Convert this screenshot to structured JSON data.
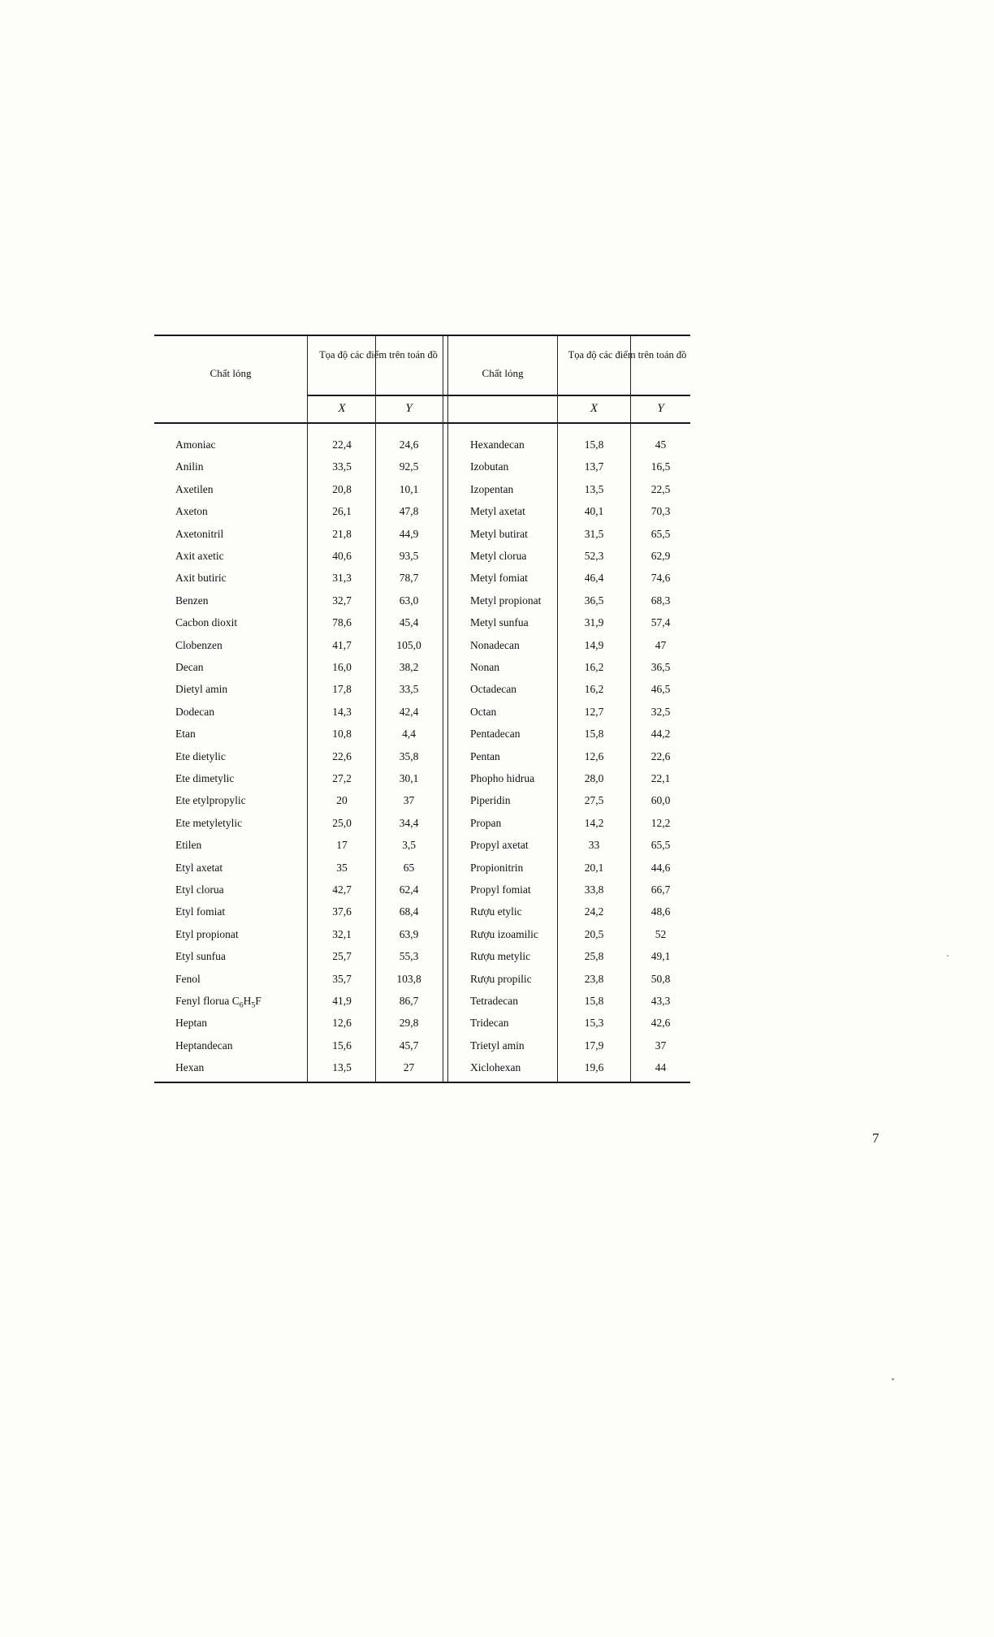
{
  "document": {
    "page_number": "7",
    "language": "vi"
  },
  "table": {
    "headers": {
      "substance": "Chất lỏng",
      "coordinates": "Tọa độ các điểm trên toán đồ",
      "x": "X",
      "y": "Y"
    },
    "left_rows": [
      {
        "name": "Amoniac",
        "x": "22,4",
        "y": "24,6"
      },
      {
        "name": "Anilin",
        "x": "33,5",
        "y": "92,5"
      },
      {
        "name": "Axetilen",
        "x": "20,8",
        "y": "10,1"
      },
      {
        "name": "Axeton",
        "x": "26,1",
        "y": "47,8"
      },
      {
        "name": "Axetonitril",
        "x": "21,8",
        "y": "44,9"
      },
      {
        "name": "Axit axetic",
        "x": "40,6",
        "y": "93,5"
      },
      {
        "name": "Axit butiric",
        "x": "31,3",
        "y": "78,7"
      },
      {
        "name": "Benzen",
        "x": "32,7",
        "y": "63,0"
      },
      {
        "name": "Cacbon dioxit",
        "x": "78,6",
        "y": "45,4"
      },
      {
        "name": "Clobenzen",
        "x": "41,7",
        "y": "105,0"
      },
      {
        "name": "Decan",
        "x": "16,0",
        "y": "38,2"
      },
      {
        "name": "Dietyl amin",
        "x": "17,8",
        "y": "33,5"
      },
      {
        "name": "Dodecan",
        "x": "14,3",
        "y": "42,4"
      },
      {
        "name": "Etan",
        "x": "10,8",
        "y": "4,4"
      },
      {
        "name": "Ete dietylic",
        "x": "22,6",
        "y": "35,8"
      },
      {
        "name": "Ete dimetylic",
        "x": "27,2",
        "y": "30,1"
      },
      {
        "name": "Ete etylpropylic",
        "x": "20",
        "y": "37"
      },
      {
        "name": "Ete metyletylic",
        "x": "25,0",
        "y": "34,4"
      },
      {
        "name": "Etilen",
        "x": "17",
        "y": "3,5"
      },
      {
        "name": "Etyl axetat",
        "x": "35",
        "y": "65"
      },
      {
        "name": "Etyl clorua",
        "x": "42,7",
        "y": "62,4"
      },
      {
        "name": "Etyl fomiat",
        "x": "37,6",
        "y": "68,4"
      },
      {
        "name": "Etyl propionat",
        "x": "32,1",
        "y": "63,9"
      },
      {
        "name": "Etyl sunfua",
        "x": "25,7",
        "y": "55,3"
      },
      {
        "name": "Fenol",
        "x": "35,7",
        "y": "103,8"
      },
      {
        "name": "Fenyl florua C6H5F",
        "name_html": "Fenyl florua C<sub>6</sub>H<sub>5</sub>F",
        "x": "41,9",
        "y": "86,7"
      },
      {
        "name": "Heptan",
        "x": "12,6",
        "y": "29,8"
      },
      {
        "name": "Heptandecan",
        "x": "15,6",
        "y": "45,7"
      },
      {
        "name": "Hexan",
        "x": "13,5",
        "y": "27"
      }
    ],
    "right_rows": [
      {
        "name": "Hexandecan",
        "x": "15,8",
        "y": "45"
      },
      {
        "name": "Izobutan",
        "x": "13,7",
        "y": "16,5"
      },
      {
        "name": "Izopentan",
        "x": "13,5",
        "y": "22,5"
      },
      {
        "name": "Metyl axetat",
        "x": "40,1",
        "y": "70,3"
      },
      {
        "name": "Metyl butirat",
        "x": "31,5",
        "y": "65,5"
      },
      {
        "name": "Metyl clorua",
        "x": "52,3",
        "y": "62,9"
      },
      {
        "name": "Metyl fomiat",
        "x": "46,4",
        "y": "74,6"
      },
      {
        "name": "Metyl propionat",
        "x": "36,5",
        "y": "68,3"
      },
      {
        "name": "Metyl sunfua",
        "x": "31,9",
        "y": "57,4"
      },
      {
        "name": "Nonadecan",
        "x": "14,9",
        "y": "47"
      },
      {
        "name": "Nonan",
        "x": "16,2",
        "y": "36,5"
      },
      {
        "name": "Octadecan",
        "x": "16,2",
        "y": "46,5"
      },
      {
        "name": "Octan",
        "x": "12,7",
        "y": "32,5"
      },
      {
        "name": "Pentadecan",
        "x": "15,8",
        "y": "44,2"
      },
      {
        "name": "Pentan",
        "x": "12,6",
        "y": "22,6"
      },
      {
        "name": "Phopho hidrua",
        "x": "28,0",
        "y": "22,1"
      },
      {
        "name": "Piperidin",
        "x": "27,5",
        "y": "60,0"
      },
      {
        "name": "Propan",
        "x": "14,2",
        "y": "12,2"
      },
      {
        "name": "Propyl axetat",
        "x": "33",
        "y": "65,5"
      },
      {
        "name": "Propionitrin",
        "x": "20,1",
        "y": "44,6"
      },
      {
        "name": "Propyl fomiat",
        "x": "33,8",
        "y": "66,7"
      },
      {
        "name": "Rượu etylic",
        "x": "24,2",
        "y": "48,6"
      },
      {
        "name": "Rượu izoamilic",
        "x": "20,5",
        "y": "52"
      },
      {
        "name": "Rượu metylic",
        "x": "25,8",
        "y": "49,1"
      },
      {
        "name": "Rượu propilic",
        "x": "23,8",
        "y": "50,8"
      },
      {
        "name": "Tetradecan",
        "x": "15,8",
        "y": "43,3"
      },
      {
        "name": "Tridecan",
        "x": "15,3",
        "y": "42,6"
      },
      {
        "name": "Trietyl amin",
        "x": "17,9",
        "y": "37"
      },
      {
        "name": "Xiclohexan",
        "x": "19,6",
        "y": "44"
      }
    ]
  }
}
